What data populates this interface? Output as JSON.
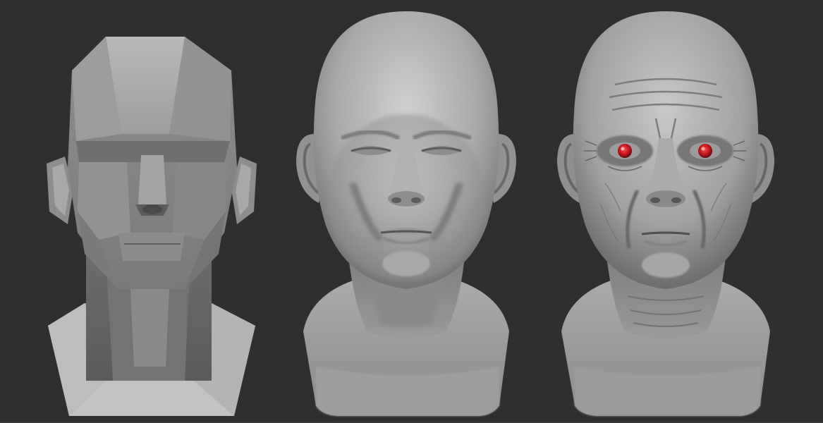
{
  "scene": {
    "description_label": "",
    "background_color": "#2f2f2f",
    "panels": [
      {
        "stage": "blockout",
        "style": "low-poly planar head"
      },
      {
        "stage": "smooth",
        "style": "smooth base head sculpt"
      },
      {
        "stage": "detailed",
        "style": "detailed wrinkled head sculpt",
        "eye_color": "#c0151a"
      }
    ]
  }
}
